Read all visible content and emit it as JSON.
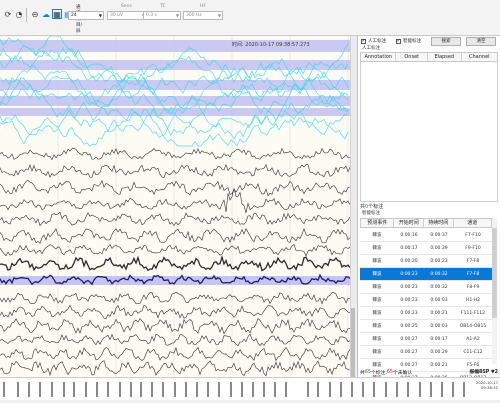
{
  "toolbar": {
    "icons": [
      "refresh-icon",
      "clock-icon",
      "montage-icon",
      "cloud-icon",
      "layout-icon",
      "screens-icon"
    ],
    "fields": [
      {
        "label": "通道数目/屏",
        "value": "24",
        "dim": false
      },
      {
        "label": "Sens",
        "value": "30 uV",
        "dim": true
      },
      {
        "label": "TC",
        "value": "0.3 s",
        "dim": true
      },
      {
        "label": "HF",
        "value": "300 Hz",
        "dim": true
      }
    ]
  },
  "eeg": {
    "timestamp": "时间: 2020-10-17 09:38:57.273",
    "accent_cyan": "#35d8e8",
    "highlight": "#b8b8f0"
  },
  "panel": {
    "manual_checkbox": "人工标注",
    "smart_checkbox": "智能标注",
    "btn_search": "搜索",
    "btn_clear": "清空",
    "manual_title": "人工标注",
    "manual_columns": [
      "Annotation",
      "Onset",
      "Elapsed",
      "Channel"
    ],
    "manual_count_prefix": "共",
    "manual_count_num": "0",
    "manual_count_suffix": "个标注",
    "smart_title": "智能标注",
    "smart_columns": [
      "预测事件",
      "开始时间",
      "持续时间",
      "通道"
    ],
    "smart_rows": [
      [
        "棘波",
        "0:00:16",
        "0:00:37",
        "F7-F10"
      ],
      [
        "棘波",
        "0:00:17",
        "0:00:39",
        "F9-F10"
      ],
      [
        "棘波",
        "0:00:20",
        "0:00:23",
        "F7-F8"
      ],
      [
        "棘波",
        "0:00:23",
        "0:00:32",
        "F7-F8"
      ],
      [
        "棘波",
        "0:00:23",
        "0:00:32",
        "F8-F9"
      ],
      [
        "棘波",
        "0:00:23",
        "0:00:03",
        "H1-H2"
      ],
      [
        "棘波",
        "0:00:23",
        "0:00:21",
        "F111-F112"
      ],
      [
        "棘波",
        "0:00:25",
        "0:00:03",
        "OB14-OB15"
      ],
      [
        "棘波",
        "0:00:27",
        "0:00:17",
        "A1-A2"
      ],
      [
        "棘波",
        "0:00:27",
        "0:00:29",
        "C11-C12"
      ],
      [
        "棘波",
        "0:00:27",
        "0:00:21",
        "F5-F6"
      ],
      [
        "棘波",
        "0:00:27",
        "0:00:26",
        "OB12-OB13"
      ]
    ],
    "selected_row": 3,
    "status_prefix": "共",
    "status_total": "65",
    "status_mid": "个标注,",
    "status_unconfirmed": "65",
    "status_suffix": "个未确认",
    "status_right": "振幅8SP ▼2"
  },
  "clock": {
    "date": "2020-10-17",
    "time": "09:38:31"
  }
}
